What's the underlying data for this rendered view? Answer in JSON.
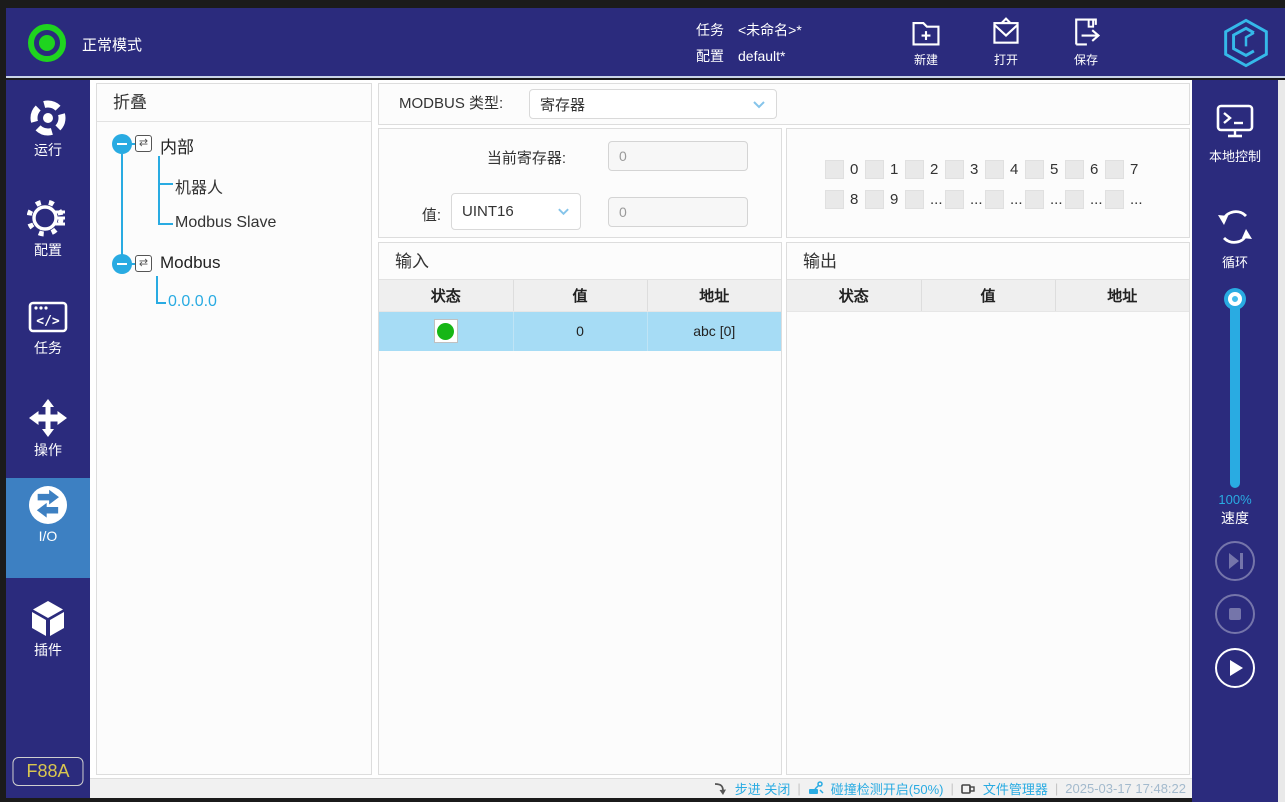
{
  "top_bar": {
    "mode": "正常模式",
    "task_label": "任务",
    "task_value": "<未命名>*",
    "config_label": "配置",
    "config_value": "default*",
    "new_label": "新建",
    "open_label": "打开",
    "save_label": "保存"
  },
  "left_sidebar": {
    "items": [
      {
        "label": "运行"
      },
      {
        "label": "配置"
      },
      {
        "label": "任务"
      },
      {
        "label": "操作"
      },
      {
        "label": "I/O"
      },
      {
        "label": "插件"
      }
    ],
    "badge": "F88A"
  },
  "tree": {
    "header": "折叠",
    "root1": {
      "label": "内部",
      "children": [
        "机器人",
        "Modbus Slave"
      ]
    },
    "root2": {
      "label": "Modbus",
      "children": [
        "0.0.0.0"
      ]
    },
    "node_icon": "⇄"
  },
  "main": {
    "modbus_type_label": "MODBUS 类型:",
    "modbus_type_value": "寄存器",
    "current_register_label": "当前寄存器:",
    "current_register_value": "0",
    "value_label": "值:",
    "value_type": "UINT16",
    "value_value": "0",
    "bits": [
      "0",
      "1",
      "2",
      "3",
      "4",
      "5",
      "6",
      "7",
      "8",
      "9",
      "...",
      "...",
      "...",
      "...",
      "...",
      "..."
    ],
    "input": {
      "title": "输入",
      "headers": [
        "状态",
        "值",
        "地址"
      ],
      "rows": [
        {
          "value": "0",
          "address": "abc [0]"
        }
      ]
    },
    "output": {
      "title": "输出",
      "headers": [
        "状态",
        "值",
        "地址"
      ],
      "rows": []
    }
  },
  "right_sidebar": {
    "local_control": "本地控制",
    "loop": "循环",
    "speed_percent": "100%",
    "speed_label": "速度"
  },
  "status_bar": {
    "step": "步进 关闭",
    "collision": "碰撞检测开启(50%)",
    "file_manager": "文件管理器",
    "timestamp": "2025-03-17 17:48:22"
  },
  "colors": {
    "navy": "#2b2b7d",
    "accent": "#29abe2",
    "selected_nav": "#3d80c2",
    "green": "#1fd41f",
    "row_highlight": "#a6dcf5",
    "badge_yellow": "#d9c64f"
  }
}
